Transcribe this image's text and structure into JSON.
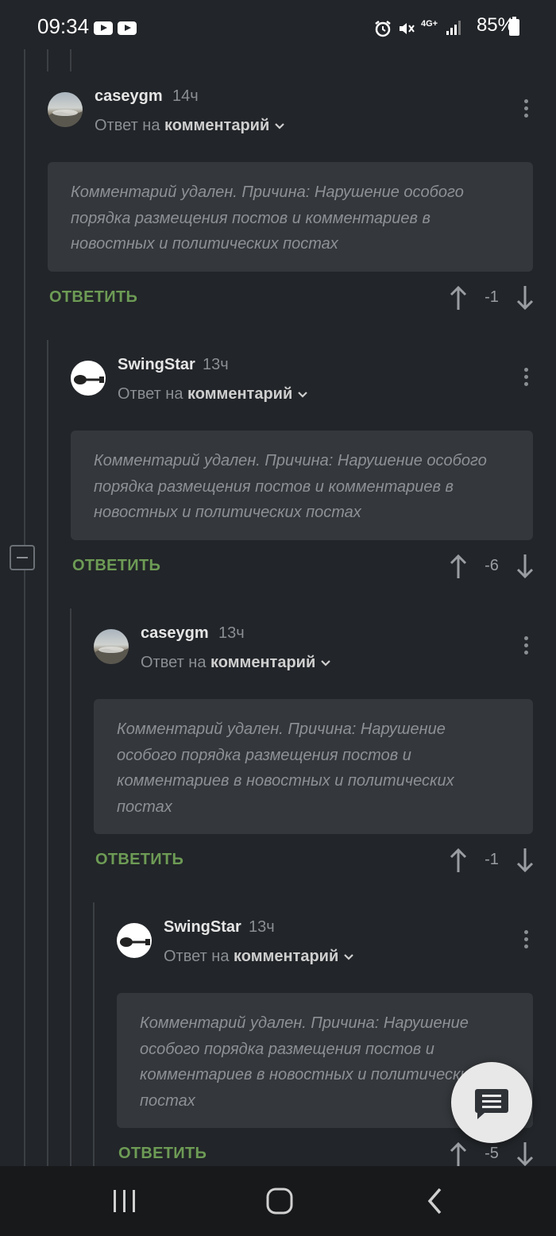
{
  "status_bar": {
    "time": "09:34",
    "network": "4G+",
    "battery": "85%",
    "icons": [
      "youtube-icon",
      "youtube-icon",
      "alarm-icon",
      "mute-icon",
      "signal-icon",
      "battery-icon"
    ]
  },
  "comments": [
    {
      "username": "caseygm",
      "time": "14ч",
      "reply_to_prefix": "Ответ на",
      "reply_to_target": "комментарий",
      "body_lines": [
        "Комментарий удален. Причина: Нарушение особого",
        "порядка размещения постов и комментариев в",
        "новостных и политических постах"
      ],
      "reply_label": "ОТВЕТИТЬ",
      "score": "-1",
      "avatar": "landscape"
    },
    {
      "username": "SwingStar",
      "time": "13ч",
      "reply_to_prefix": "Ответ на",
      "reply_to_target": "комментарий",
      "body_lines": [
        "Комментарий удален. Причина: Нарушение особого",
        "порядка размещения постов и комментариев в",
        "новостных и политических постах"
      ],
      "reply_label": "ОТВЕТИТЬ",
      "score": "-6",
      "avatar": "guitar"
    },
    {
      "username": "caseygm",
      "time": "13ч",
      "reply_to_prefix": "Ответ на",
      "reply_to_target": "комментарий",
      "body_lines": [
        "Комментарий удален. Причина: Нарушение",
        "особого порядка размещения постов и",
        "комментариев в новостных и политических",
        "постах"
      ],
      "reply_label": "ОТВЕТИТЬ",
      "score": "-1",
      "avatar": "landscape"
    },
    {
      "username": "SwingStar",
      "time": "13ч",
      "reply_to_prefix": "Ответ на",
      "reply_to_target": "комментарий",
      "body_lines": [
        "Комментарий удален. Причина: Нарушение",
        "особого порядка размещения постов и",
        "комментариев в новостных и политических",
        "постах"
      ],
      "reply_label": "ОТВЕТИТЬ",
      "score": "-5",
      "avatar": "guitar"
    }
  ],
  "colors": {
    "background": "#222529",
    "comment_box": "#34373b",
    "reply_green": "#6d9b55",
    "muted_text": "#8a8f94"
  }
}
